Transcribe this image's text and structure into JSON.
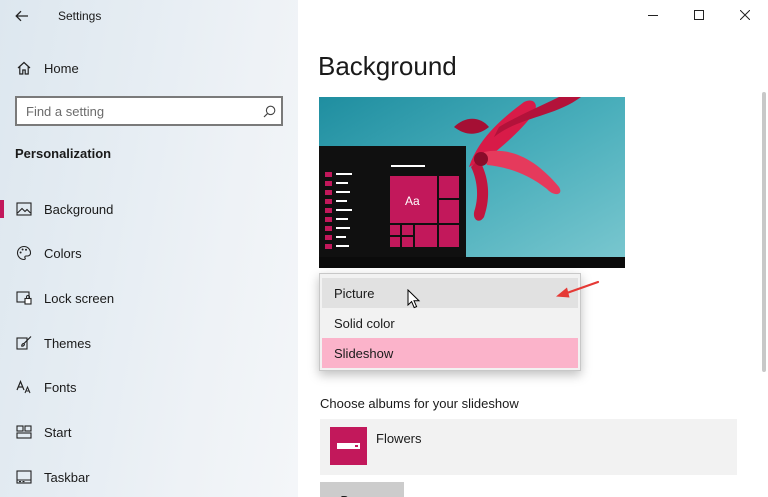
{
  "window": {
    "app_title": "Settings"
  },
  "sidebar": {
    "home_label": "Home",
    "search": {
      "placeholder": "Find a setting"
    },
    "section_title": "Personalization",
    "items": [
      {
        "label": "Background",
        "icon": "picture-icon",
        "selected": true
      },
      {
        "label": "Colors",
        "icon": "palette-icon",
        "selected": false
      },
      {
        "label": "Lock screen",
        "icon": "lock-screen-icon",
        "selected": false
      },
      {
        "label": "Themes",
        "icon": "brush-icon",
        "selected": false
      },
      {
        "label": "Fonts",
        "icon": "fonts-icon",
        "selected": false
      },
      {
        "label": "Start",
        "icon": "start-icon",
        "selected": false
      },
      {
        "label": "Taskbar",
        "icon": "taskbar-icon",
        "selected": false
      }
    ]
  },
  "main": {
    "title": "Background",
    "preview": {
      "tile_label": "Aa"
    },
    "background_dropdown": {
      "options": [
        {
          "label": "Picture",
          "state": "hover"
        },
        {
          "label": "Solid color",
          "state": "normal"
        },
        {
          "label": "Slideshow",
          "state": "selected"
        }
      ]
    },
    "albums_title": "Choose albums for your slideshow",
    "album": {
      "name": "Flowers"
    },
    "browse_label": "Browse"
  },
  "colors": {
    "accent": "#c2185b",
    "selected_option": "#fbb3ca",
    "annotation_arrow": "#e53935"
  }
}
